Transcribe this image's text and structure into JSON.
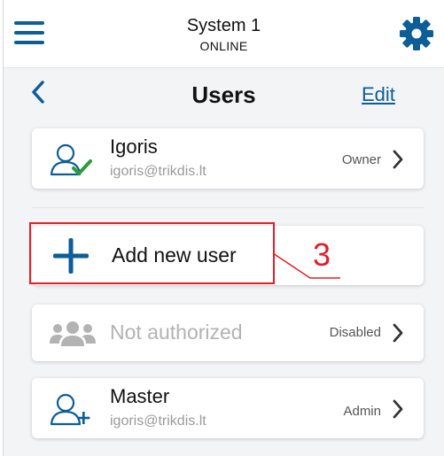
{
  "header": {
    "system_name": "System 1",
    "system_status": "ONLINE",
    "menu_icon": "hamburger-menu-icon",
    "settings_icon": "gear-icon"
  },
  "nav": {
    "back_icon": "chevron-left-icon",
    "title": "Users",
    "edit_label": "Edit"
  },
  "users": [
    {
      "name": "Igoris",
      "email": "igoris@trikdis.lt",
      "role": "Owner",
      "icon": "user-check-icon"
    },
    {
      "name": "Master",
      "email": "igoris@trikdis.lt",
      "role": "Admin",
      "icon": "user-add-icon"
    }
  ],
  "add_user": {
    "label": "Add new user",
    "icon": "plus-icon"
  },
  "not_authorized": {
    "label": "Not authorized",
    "status": "Disabled",
    "icon": "users-group-icon"
  },
  "annotation": {
    "number": "3"
  },
  "colors": {
    "accent": "#0c5d98",
    "check": "#2e9a3a",
    "annotation": "#e0202a",
    "muted_text": "#9a9a9a"
  }
}
